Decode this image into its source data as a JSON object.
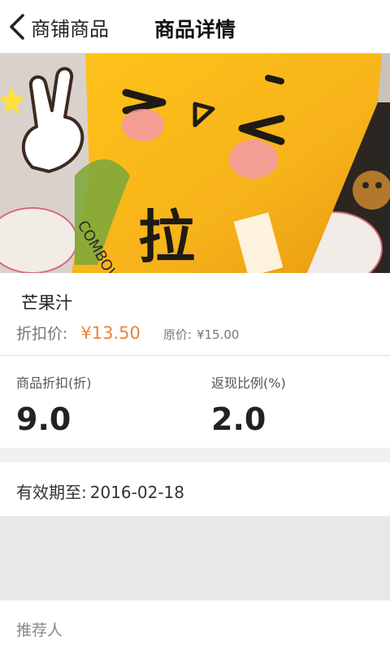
{
  "nav": {
    "back_label": "商铺商品",
    "title": "商品详情"
  },
  "product": {
    "name": "芒果汁",
    "price_label": "折扣价:",
    "price": "¥13.50",
    "original_price_label": "原价:",
    "original_price": "¥15.00",
    "price_color": "#f08038"
  },
  "stats": {
    "discount_label": "商品折扣(折)",
    "discount_value": "9.0",
    "cashback_label": "返现比例(%)",
    "cashback_value": "2.0"
  },
  "expiry": {
    "label": "有效期至:",
    "date": "2016-02-18"
  },
  "referrer": {
    "label": "推荐人"
  },
  "hero_icons": [
    "peace-hand-icon",
    "face-doodle",
    "cup-icon"
  ]
}
